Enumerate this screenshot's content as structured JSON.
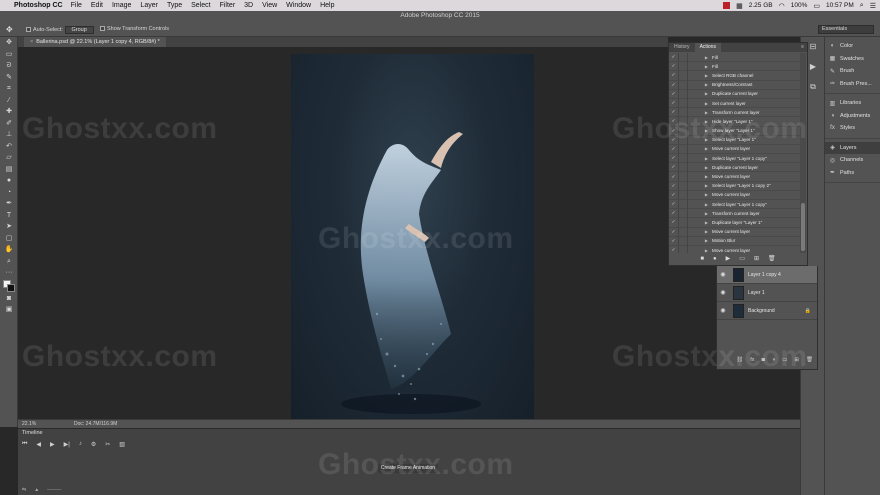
{
  "menubar": {
    "app_name": "Photoshop CC",
    "items": [
      "File",
      "Edit",
      "Image",
      "Layer",
      "Type",
      "Select",
      "Filter",
      "3D",
      "View",
      "Window",
      "Help"
    ],
    "memory": "2.25 GB",
    "battery": "100%",
    "time": "10:57 PM"
  },
  "window": {
    "title": "Adobe Photoshop CC 2015"
  },
  "options_bar": {
    "auto_select_label": "Auto-Select:",
    "auto_select_value": "Group",
    "show_transform_label": "Show Transform Controls",
    "workspace": "Essentials"
  },
  "document": {
    "tab_label": "Ballerina.psd @ 22.1% (Layer 1 copy 4, RGB/8#) *",
    "zoom": "22.1%",
    "doc_info": "Doc: 24.7M/116.9M"
  },
  "actions_panel": {
    "tabs": [
      "History",
      "Actions"
    ],
    "active_tab": "Actions",
    "items": [
      "Fill",
      "Fill",
      "Select RGB channel",
      "Brightness/Contrast",
      "Duplicate current layer",
      "Set current layer",
      "Transform current layer",
      "Hide layer \"Layer 1\"",
      "Show layer \"Layer 1\"",
      "Select layer \"Layer 1\"",
      "Move current layer",
      "Select layer \"Layer 1 copy\"",
      "Duplicate current layer",
      "Move current layer",
      "Select layer \"Layer 1 copy 2\"",
      "Move current layer",
      "Select layer \"Layer 1 copy\"",
      "Transform current layer",
      "Duplicate layer \"Layer 1\"",
      "Move current layer",
      "Motion Blur",
      "Move current layer"
    ]
  },
  "layers_panel": {
    "layers": [
      {
        "name": "Layer 1 copy 4",
        "selected": true,
        "locked": false
      },
      {
        "name": "Layer 1",
        "selected": false,
        "locked": false
      },
      {
        "name": "Background",
        "selected": false,
        "locked": true
      }
    ]
  },
  "right_dock": {
    "groups": [
      [
        "Color",
        "Swatches",
        "Brush",
        "Brush Pres..."
      ],
      [
        "Libraries",
        "Adjustments",
        "Styles"
      ],
      [
        "Layers",
        "Channels",
        "Paths"
      ]
    ],
    "active": "Layers"
  },
  "timeline": {
    "title": "Timeline",
    "create_button": "Create Frame Animation"
  },
  "watermark": {
    "text": "Ghostxx.com"
  }
}
